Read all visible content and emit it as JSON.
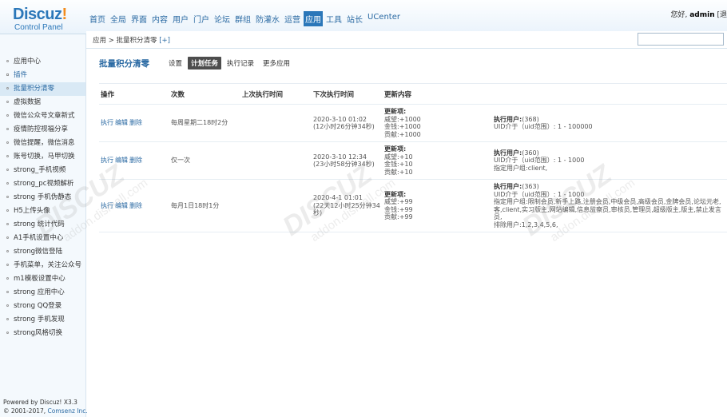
{
  "header": {
    "logo_title": "Discuz",
    "logo_bang": "!",
    "logo_subtitle": "Control Panel",
    "nav": [
      "首页",
      "全局",
      "界面",
      "内容",
      "用户",
      "门户",
      "论坛",
      "群组",
      "防灌水",
      "运营",
      "应用",
      "工具",
      "站长",
      "UCenter"
    ],
    "active_nav": "应用",
    "greeting": "您好,",
    "username": "admin",
    "bracket": "[退"
  },
  "breadcrumb": {
    "text": "应用 > 批量积分清零",
    "plus": "[+]"
  },
  "sidebar": {
    "items": [
      {
        "label": "应用中心",
        "type": "normal"
      },
      {
        "label": "插件",
        "type": "group"
      },
      {
        "label": "批量积分清零",
        "type": "active"
      },
      {
        "label": "虚拟数据",
        "type": "normal"
      },
      {
        "label": "微信公众号文章新式",
        "type": "normal"
      },
      {
        "label": "疫情防控视福分享",
        "type": "normal"
      },
      {
        "label": "微信提醒，微信消息",
        "type": "normal"
      },
      {
        "label": "账号切换，马甲切换",
        "type": "normal"
      },
      {
        "label": "strong_手机视频",
        "type": "normal"
      },
      {
        "label": "strong_pc视频解析",
        "type": "normal"
      },
      {
        "label": "strong 手机伪静态",
        "type": "normal"
      },
      {
        "label": "H5上传头像",
        "type": "normal"
      },
      {
        "label": "strong 统计代码",
        "type": "normal"
      },
      {
        "label": "A1手机设置中心",
        "type": "normal"
      },
      {
        "label": "strong微信登陆",
        "type": "normal"
      },
      {
        "label": "手机菜单，关注公众号",
        "type": "normal"
      },
      {
        "label": "m1模板设置中心",
        "type": "normal"
      },
      {
        "label": "strong 应用中心",
        "type": "normal"
      },
      {
        "label": "strong QQ登录",
        "type": "normal"
      },
      {
        "label": "strong 手机发现",
        "type": "normal"
      },
      {
        "label": "strong风格切换",
        "type": "normal"
      }
    ],
    "powered_line1": "Powered by Discuz! X3.3",
    "powered_copy": "© 2001-2017,",
    "powered_link": "Comsenz Inc."
  },
  "main": {
    "title": "批量积分清零",
    "tabs": [
      "设置",
      "计划任务",
      "执行记录",
      "更多应用"
    ],
    "active_tab": "计划任务",
    "columns": [
      "操作",
      "次数",
      "上次执行时间",
      "下次执行时间",
      "更新内容",
      ""
    ],
    "rows": [
      {
        "ops": [
          "执行",
          "编辑",
          "删除"
        ],
        "frequency": "每周星期二18时2分",
        "last_run": "",
        "next_run": "2020-3-10 01:02",
        "next_remaining": "(12小时26分钟34秒)",
        "update_head": "更新项:",
        "update_lines": [
          "威望:+1000",
          "金钱:+1000",
          "贡献:+1000"
        ],
        "user_head": "执行用户:",
        "user_count": "(368)",
        "user_lines": [
          "UID介于（uid范围）: 1 - 100000"
        ]
      },
      {
        "ops": [
          "执行",
          "编辑",
          "删除"
        ],
        "frequency": "仅一次",
        "last_run": "",
        "next_run": "2020-3-10 12:34",
        "next_remaining": "(23小时58分钟34秒)",
        "update_head": "更新项:",
        "update_lines": [
          "威望:+10",
          "金钱:+10",
          "贡献:+10"
        ],
        "user_head": "执行用户:",
        "user_count": "(360)",
        "user_lines": [
          "UID介于（uid范围）: 1 - 1000",
          "指定用户组:client,"
        ]
      },
      {
        "ops": [
          "执行",
          "编辑",
          "删除"
        ],
        "frequency": "每月1日18时1分",
        "last_run": "",
        "next_run": "2020-4-1 01:01",
        "next_remaining": "(22天12小时25分钟34秒)",
        "update_head": "更新项:",
        "update_lines": [
          "威望:+99",
          "金钱:+99",
          "贡献:+99"
        ],
        "user_head": "执行用户:",
        "user_count": "(363)",
        "user_lines": [
          "UID介于（uid范围）: 1 - 1000",
          "指定用户组:限制会员,新手上路,注册会员,中级会员,高级会员,金牌会员,论坛元老,客,client,实习版主,网站编辑,信息监察员,审核员,管理员,超级版主,版主,禁止发言员,",
          "排除用户:1,2,3,4,5,6,"
        ]
      }
    ]
  },
  "watermark": {
    "big": "DISCUZ",
    "small": "addon.dismall.com"
  }
}
